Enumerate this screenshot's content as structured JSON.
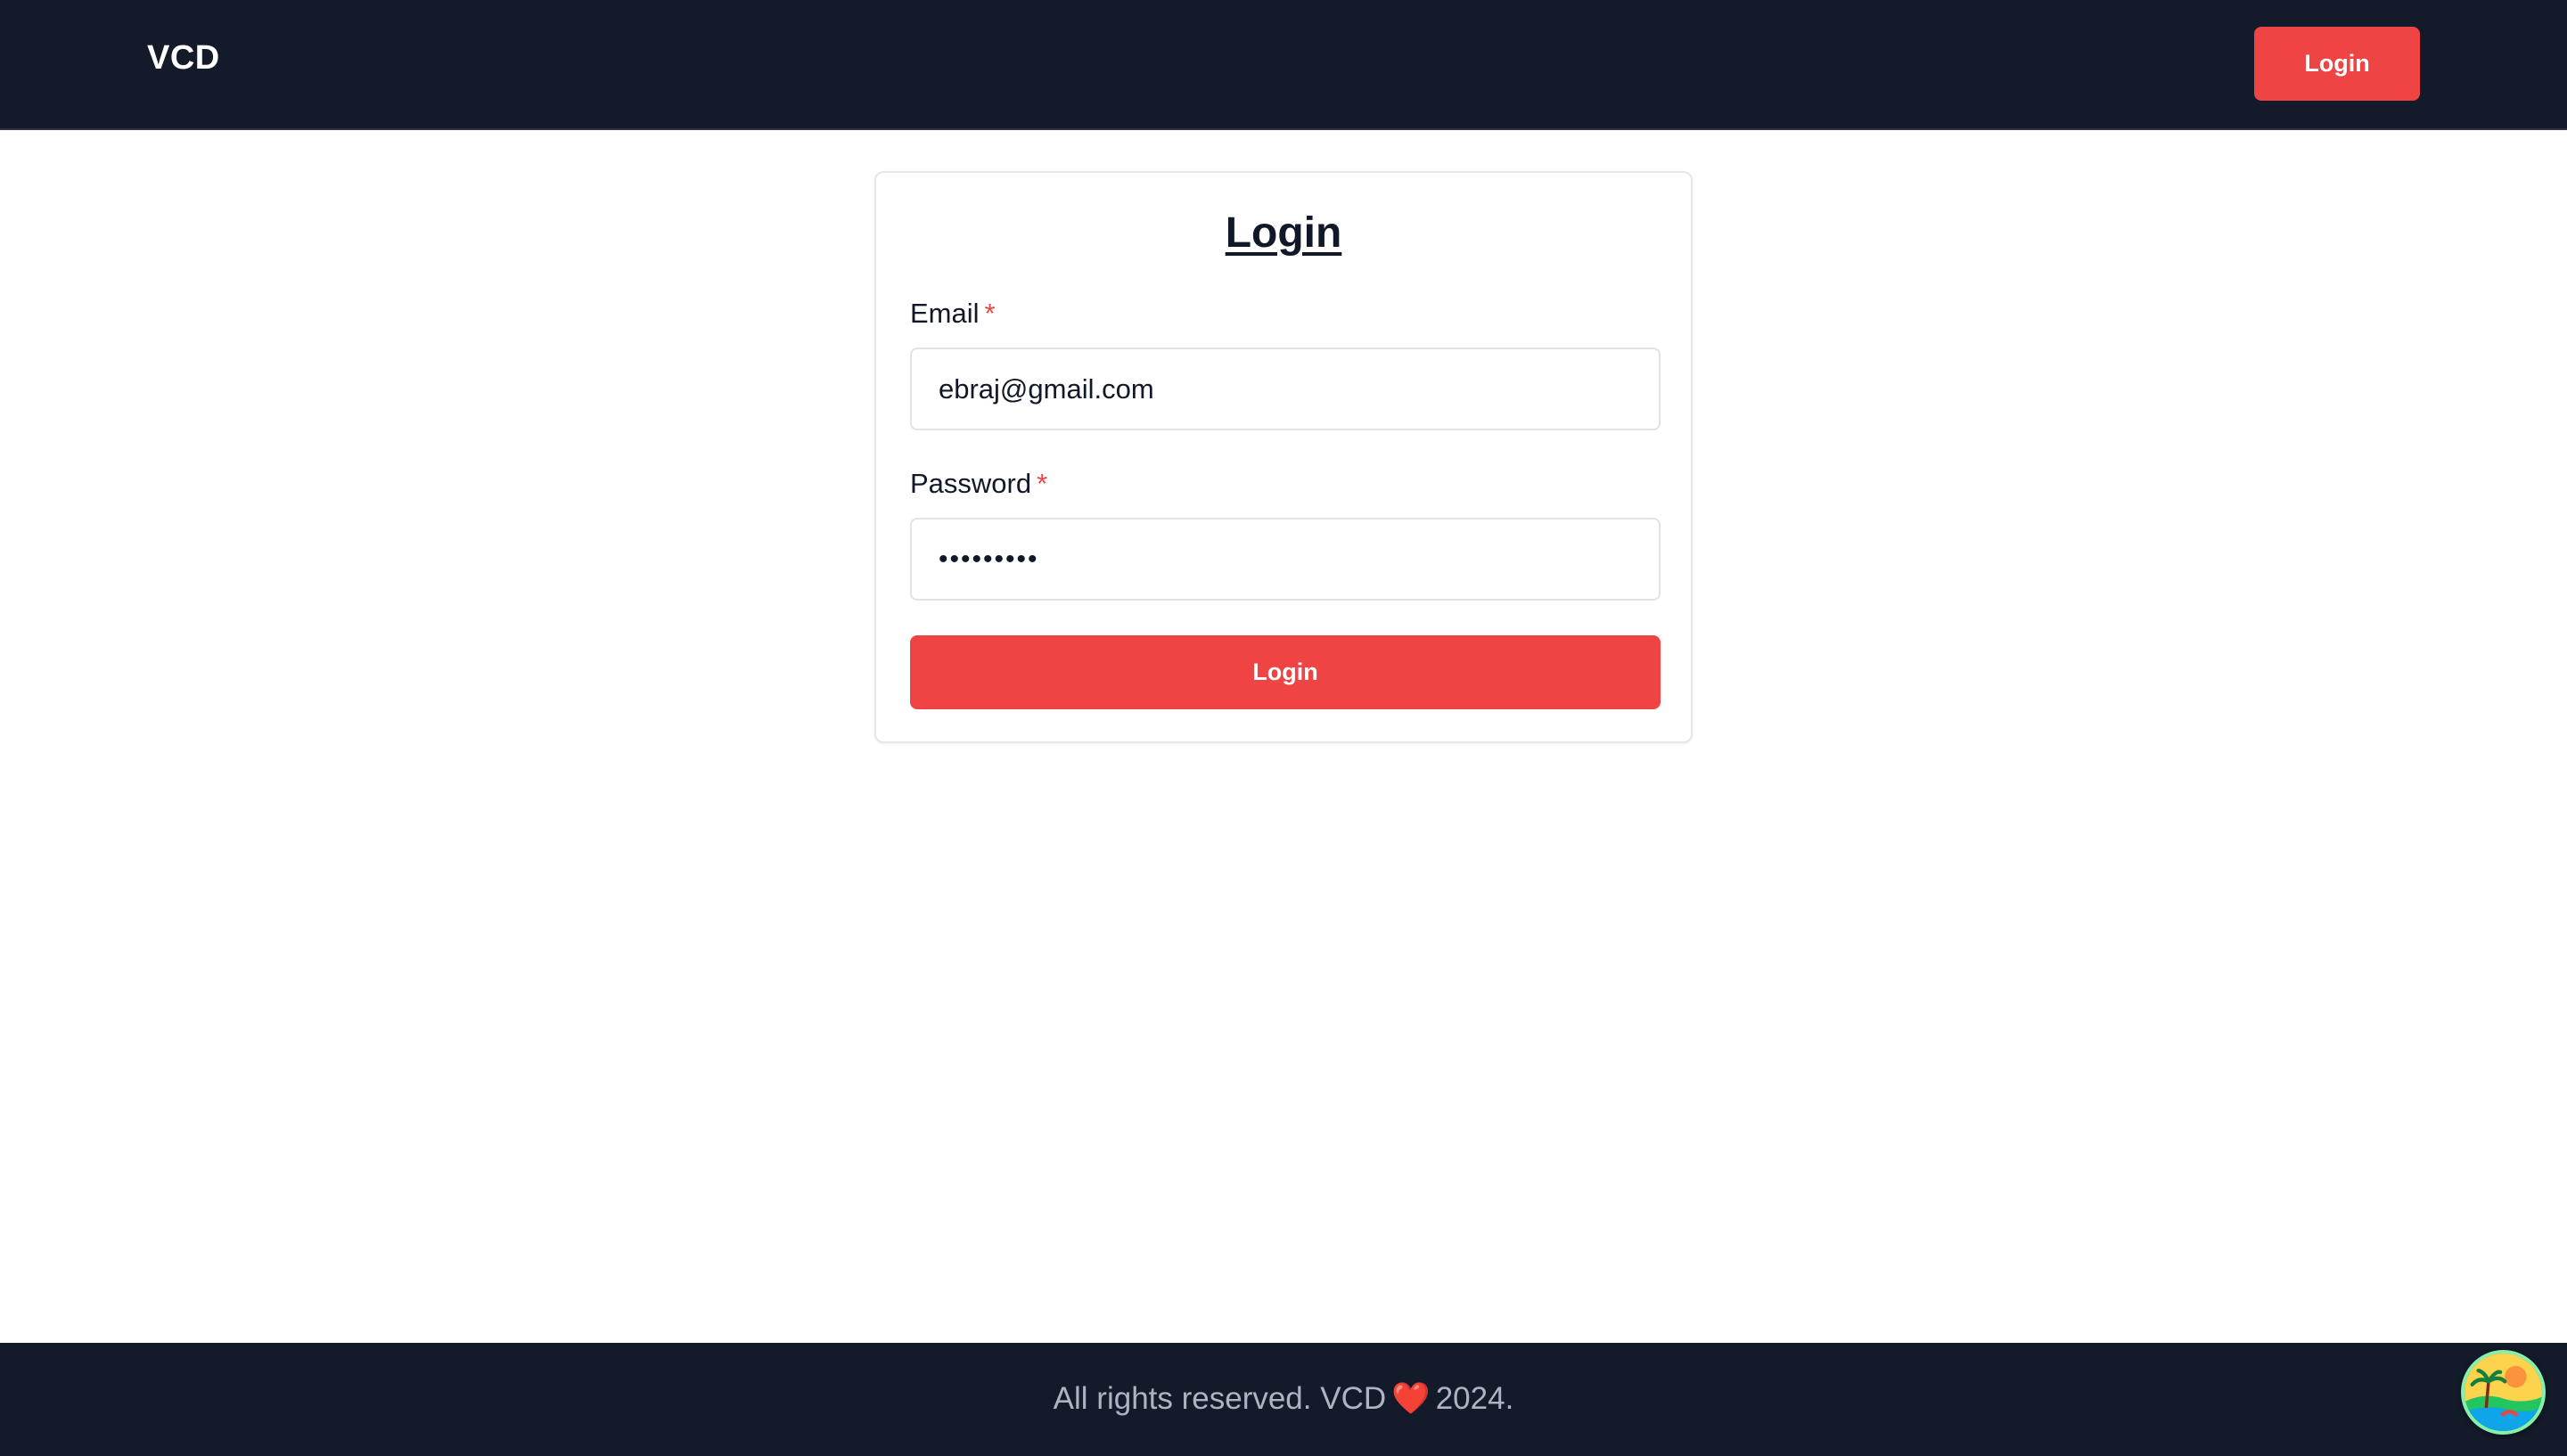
{
  "navbar": {
    "brand": "VCD",
    "login_label": "Login"
  },
  "form": {
    "title": "Login",
    "email": {
      "label": "Email",
      "required_mark": "*",
      "value": "ebraj@gmail.com"
    },
    "password": {
      "label": "Password",
      "required_mark": "*",
      "value": "•••••••••"
    },
    "submit_label": "Login"
  },
  "footer": {
    "text_before": "All rights reserved. VCD",
    "heart": "❤️",
    "text_after": "2024."
  },
  "colors": {
    "nav_bg": "#131a2a",
    "accent": "#ef4444",
    "footer_text": "#aeb4bf"
  },
  "icons": {
    "avatar": "beach-sunset-avatar-icon"
  }
}
